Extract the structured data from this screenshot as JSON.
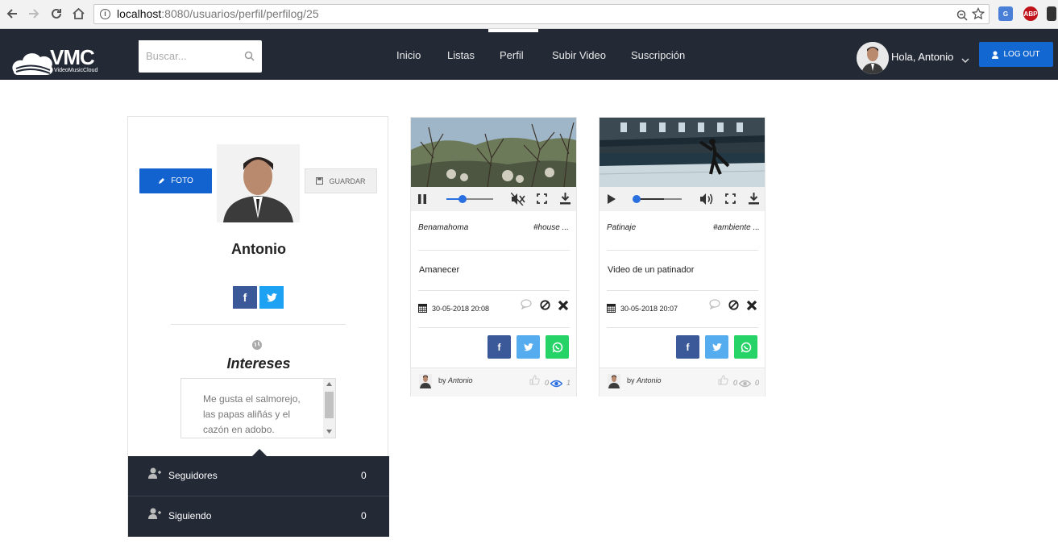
{
  "browser": {
    "url_host": "localhost",
    "url_rest": ":8080/usuarios/perfil/perfilog/25"
  },
  "header": {
    "logo_text": "VMC",
    "logo_sub": "VideoMusicCloud",
    "search_placeholder": "Buscar...",
    "nav": [
      "Inicio",
      "Listas",
      "Perfil",
      "Subir Video",
      "Suscripción"
    ],
    "greeting": "Hola, Antonio",
    "logout_label": "LOG OUT"
  },
  "profile": {
    "foto_label": "FOTO",
    "guardar_label": "GUARDAR",
    "name": "Antonio",
    "facebook_glyph": "f",
    "interests_title": "Intereses",
    "interests_text": "Me gusta el salmorejo, las papas aliñás y el cazón en adobo.",
    "seguidores_label": "Seguidores",
    "seguidores_count": "0",
    "siguiendo_label": "Siguiendo",
    "siguiendo_count": "0"
  },
  "videos": [
    {
      "title": "Benamahoma",
      "tag": "#house ...",
      "description": "Amanecer",
      "date": "30-05-2018 20:08",
      "facebook_glyph": "f",
      "by_label": "by",
      "author": "Antonio",
      "likes": "0",
      "views": "1"
    },
    {
      "title": "Patinaje",
      "tag": "#ambiente ...",
      "description": "Video de un patinador",
      "date": "30-05-2018 20:07",
      "facebook_glyph": "f",
      "by_label": "by",
      "author": "Antonio",
      "likes": "0",
      "views": "0"
    }
  ],
  "colors": {
    "header_bg": "#232a36",
    "primary_blue": "#1263cf",
    "facebook": "#3b5998",
    "twitter": "#55acee",
    "whatsapp": "#25d366"
  }
}
